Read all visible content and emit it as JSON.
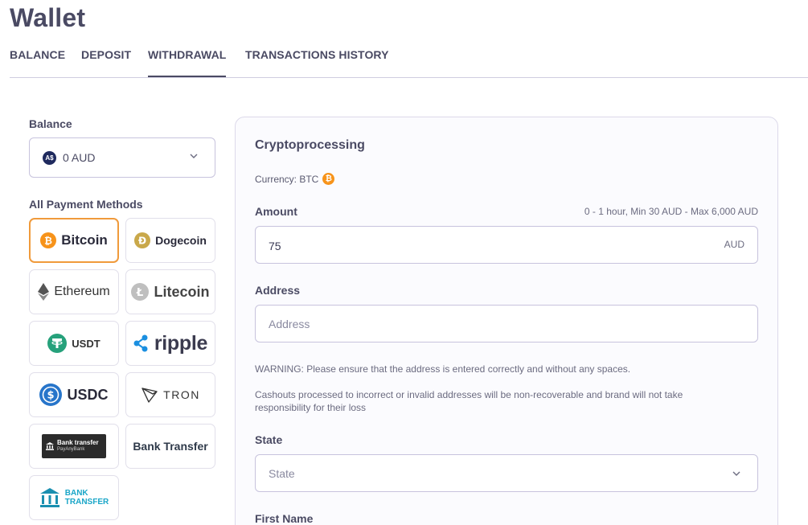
{
  "page": {
    "title": "Wallet"
  },
  "tabs": [
    {
      "label": "BALANCE"
    },
    {
      "label": "DEPOSIT"
    },
    {
      "label": "WITHDRAWAL"
    },
    {
      "label": "TRANSACTIONS HISTORY"
    }
  ],
  "balance": {
    "label": "Balance",
    "badge": "A$",
    "value": "0 AUD"
  },
  "payment_methods": {
    "label": "All Payment Methods",
    "items": [
      {
        "label": "Bitcoin",
        "icon": "bitcoin-icon"
      },
      {
        "label": "Dogecoin",
        "icon": "dogecoin-icon"
      },
      {
        "label": "Ethereum",
        "icon": "ethereum-icon"
      },
      {
        "label": "Litecoin",
        "icon": "litecoin-icon"
      },
      {
        "label": "USDT",
        "icon": "tether-icon"
      },
      {
        "label": "ripple",
        "icon": "ripple-icon"
      },
      {
        "label": "USDC",
        "icon": "usdc-icon"
      },
      {
        "label": "TRON",
        "icon": "tron-icon"
      },
      {
        "label": "Bank transfer",
        "sublabel": "PayAnyBank",
        "icon": "bank-icon"
      },
      {
        "label": "Bank Transfer"
      },
      {
        "label": "BANK",
        "label2": "TRANSFER",
        "icon": "bank-building-icon"
      }
    ]
  },
  "form": {
    "title": "Cryptoprocessing",
    "currency_text": "Currency: BTC",
    "amount": {
      "label": "Amount",
      "hint": "0 - 1 hour, Min 30 AUD - Max 6,000 AUD",
      "value": "75",
      "suffix": "AUD"
    },
    "address": {
      "label": "Address",
      "placeholder": "Address"
    },
    "warning": "WARNING: Please ensure that the address is entered correctly and without any spaces.",
    "notice": "Cashouts processed to incorrect or invalid addresses will be non-recoverable and brand will not take responsibility for their loss",
    "state": {
      "label": "State",
      "placeholder": "State"
    },
    "first_name": {
      "label": "First Name"
    }
  },
  "colors": {
    "accent": "#f09a3b",
    "bitcoin": "#f7931a",
    "text": "#4a4a63"
  }
}
